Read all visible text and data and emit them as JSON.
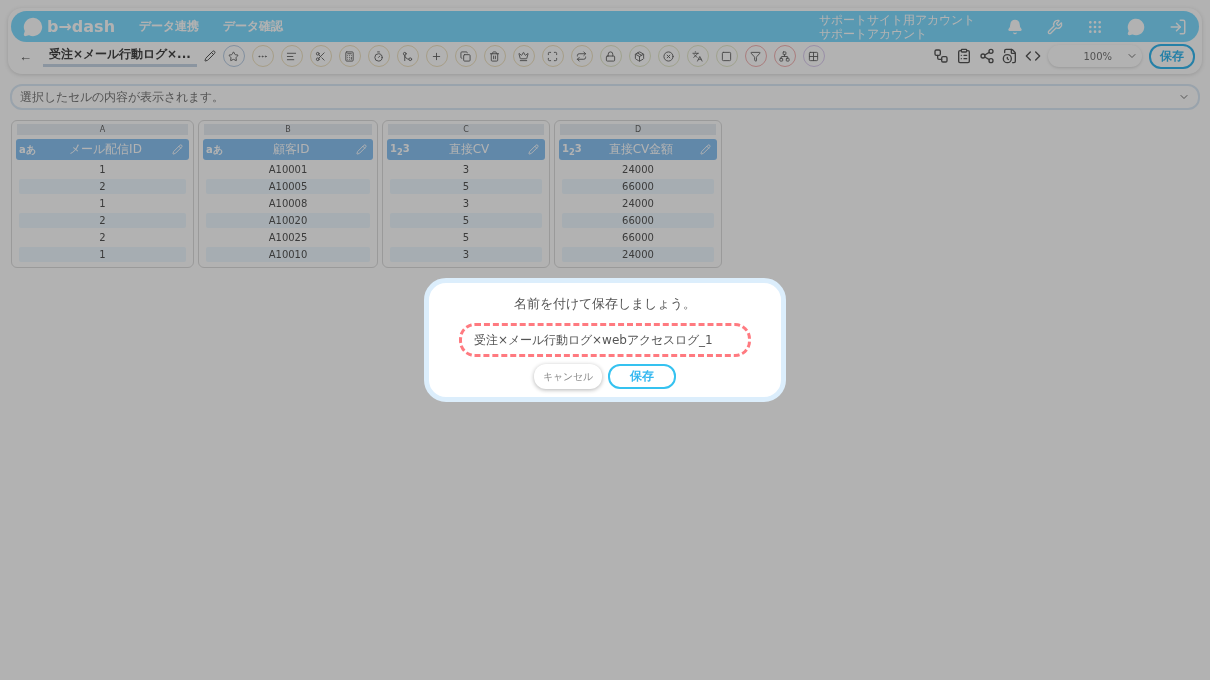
{
  "header": {
    "logo": "b→dash",
    "nav": [
      "データ連携",
      "データ確認"
    ],
    "account": [
      "サポートサイト用アカウント",
      "サポートアカウント"
    ]
  },
  "toolbar": {
    "back": "←",
    "title": "受注×メール行動ログ×...",
    "zoom": "100%",
    "save": "保存"
  },
  "cell_bar": {
    "placeholder": "選択したセルの内容が表示されます。"
  },
  "columns": [
    {
      "letter": "A",
      "type_label": "aあ",
      "name": "メール配信ID",
      "cells": [
        "1",
        "2",
        "1",
        "2",
        "2",
        "1"
      ]
    },
    {
      "letter": "B",
      "type_label": "aあ",
      "name": "顧客ID",
      "cells": [
        "A10001",
        "A10005",
        "A10008",
        "A10020",
        "A10025",
        "A10010"
      ]
    },
    {
      "letter": "C",
      "type_label": "1$_{2}$3",
      "name": "直接CV",
      "cells": [
        "3",
        "5",
        "3",
        "5",
        "5",
        "3"
      ]
    },
    {
      "letter": "D",
      "type_label": "1$_{2}$3",
      "name": "直接CV金額",
      "cells": [
        "24000",
        "66000",
        "24000",
        "66000",
        "66000",
        "24000"
      ]
    }
  ],
  "dialog": {
    "title": "名前を付けて保存しましょう。",
    "value": "受注×メール行動ログ×webアクセスログ_1",
    "cancel": "キャンセル",
    "save": "保存"
  }
}
